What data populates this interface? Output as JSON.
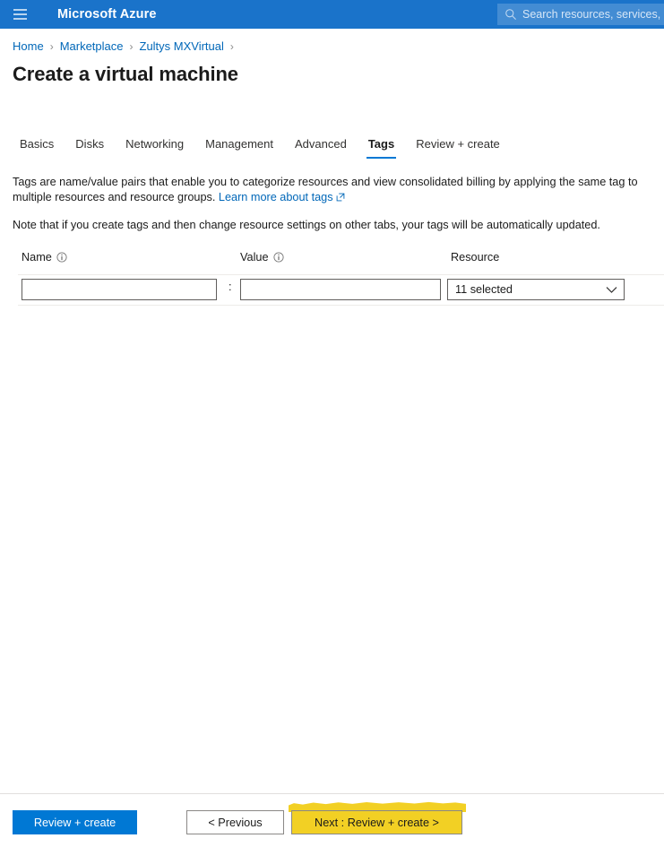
{
  "header": {
    "menu_icon": "hamburger-menu-icon",
    "brand": "Microsoft Azure",
    "search_icon": "search-icon",
    "search_placeholder": "Search resources, services,"
  },
  "breadcrumb": {
    "items": [
      {
        "label": "Home"
      },
      {
        "label": "Marketplace"
      },
      {
        "label": "Zultys MXVirtual"
      }
    ],
    "separator": "›"
  },
  "page": {
    "title": "Create a virtual machine"
  },
  "tabs": [
    {
      "label": "Basics",
      "active": false
    },
    {
      "label": "Disks",
      "active": false
    },
    {
      "label": "Networking",
      "active": false
    },
    {
      "label": "Management",
      "active": false
    },
    {
      "label": "Advanced",
      "active": false
    },
    {
      "label": "Tags",
      "active": true
    },
    {
      "label": "Review + create",
      "active": false
    }
  ],
  "content": {
    "description_part1": "Tags are name/value pairs that enable you to categorize resources and view consolidated billing by applying the same tag to multiple resources and resource groups. ",
    "learn_more_label": "Learn more about tags",
    "learn_more_icon": "external-link-icon",
    "note": "Note that if you create tags and then change resource settings on other tabs, your tags will be automatically updated."
  },
  "tags_table": {
    "columns": {
      "name": "Name",
      "name_info_icon": "info-icon",
      "value": "Value",
      "value_info_icon": "info-icon",
      "resource": "Resource"
    },
    "rows": [
      {
        "name_value": "",
        "name_placeholder": "",
        "separator": ":",
        "value_value": "",
        "value_placeholder": "",
        "resource_selected": "11 selected",
        "resource_chevron_icon": "chevron-down-icon"
      }
    ]
  },
  "footer": {
    "review_create_label": "Review + create",
    "previous_label": "< Previous",
    "next_label": "Next : Review + create >"
  },
  "colors": {
    "azure_blue": "#1a73ca",
    "primary_button": "#0078d4",
    "link": "#0067b8",
    "tab_underline": "#0078d4",
    "highlight_yellow": "#f2d024",
    "text": "#1b1b1b"
  }
}
